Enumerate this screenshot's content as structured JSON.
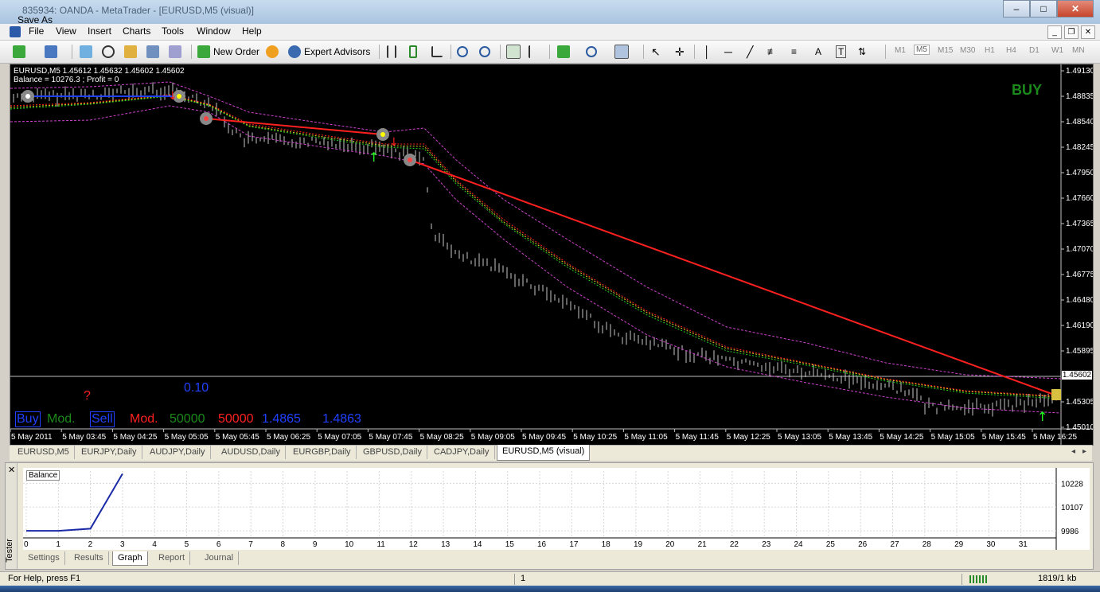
{
  "window": {
    "title": "835934: OANDA - MetaTrader - [EURUSD,M5 (visual)]",
    "save_as": "Save As",
    "min": "–",
    "max": "□",
    "close": "✕"
  },
  "menu": [
    "File",
    "View",
    "Insert",
    "Charts",
    "Tools",
    "Window",
    "Help"
  ],
  "toolbar": {
    "new_order": "New Order",
    "expert_advisors": "Expert Advisors",
    "timeframes": [
      "M1",
      "M5",
      "M15",
      "M30",
      "H1",
      "H4",
      "D1",
      "W1",
      "MN"
    ],
    "active_timeframe": "M5"
  },
  "chart": {
    "header": "EURUSD,M5  1.45612 1.45632 1.45602 1.45602",
    "balance_line": "Balance = 10276.3 ; Profit = 0",
    "signal": "BUY",
    "signal_color": "#1a8a1a",
    "lot": "0.10",
    "question": "?",
    "controls": {
      "buy": "Buy",
      "mod1": "Mod.",
      "sell": "Sell",
      "mod2": "Mod.",
      "v1": "50000",
      "v2": "50000",
      "p1": "1.4865",
      "p2": "1.4863"
    },
    "price_axis": [
      "1.49130",
      "1.48835",
      "1.48540",
      "1.48245",
      "1.47950",
      "1.47660",
      "1.47365",
      "1.47070",
      "1.46775",
      "1.46480",
      "1.46190",
      "1.45895",
      "1.45602",
      "1.45305",
      "1.45010"
    ],
    "current_price": "1.45602",
    "time_axis": [
      "5 May 2011",
      "5 May 03:45",
      "5 May 04:25",
      "5 May 05:05",
      "5 May 05:45",
      "5 May 06:25",
      "5 May 07:05",
      "5 May 07:45",
      "5 May 08:25",
      "5 May 09:05",
      "5 May 09:45",
      "5 May 10:25",
      "5 May 11:05",
      "5 May 11:45",
      "5 May 12:25",
      "5 May 13:05",
      "5 May 13:45",
      "5 May 14:25",
      "5 May 15:05",
      "5 May 15:45",
      "5 May 16:25"
    ]
  },
  "chart_tabs": [
    "EURUSD,M5",
    "EURJPY,Daily",
    "AUDJPY,Daily",
    "AUDUSD,Daily",
    "EURGBP,Daily",
    "GBPUSD,Daily",
    "CADJPY,Daily",
    "EURUSD,M5 (visual)"
  ],
  "active_chart_tab": "EURUSD,M5 (visual)",
  "tester": {
    "side_label": "Tester",
    "graph_label": "Balance",
    "y_ticks": [
      "10228",
      "10107",
      "9986"
    ],
    "x_ticks": [
      "0",
      "1",
      "2",
      "3",
      "4",
      "5",
      "6",
      "7",
      "8",
      "9",
      "10",
      "11",
      "12",
      "13",
      "14",
      "15",
      "16",
      "17",
      "18",
      "19",
      "20",
      "21",
      "22",
      "23",
      "24",
      "25",
      "26",
      "27",
      "28",
      "29",
      "30",
      "31"
    ],
    "chart_data": {
      "type": "line",
      "title": "Balance",
      "x": [
        0,
        1,
        2,
        3
      ],
      "y": [
        9986,
        9986,
        9997,
        10276.3
      ],
      "ylim": [
        9950,
        10290
      ],
      "xlim": [
        0,
        32
      ]
    },
    "tabs": [
      "Settings",
      "Results",
      "Graph",
      "Report",
      "Journal"
    ],
    "active_tab": "Graph"
  },
  "status": {
    "help": "For Help, press F1",
    "middle": "1",
    "traffic": "1819/1 kb"
  }
}
